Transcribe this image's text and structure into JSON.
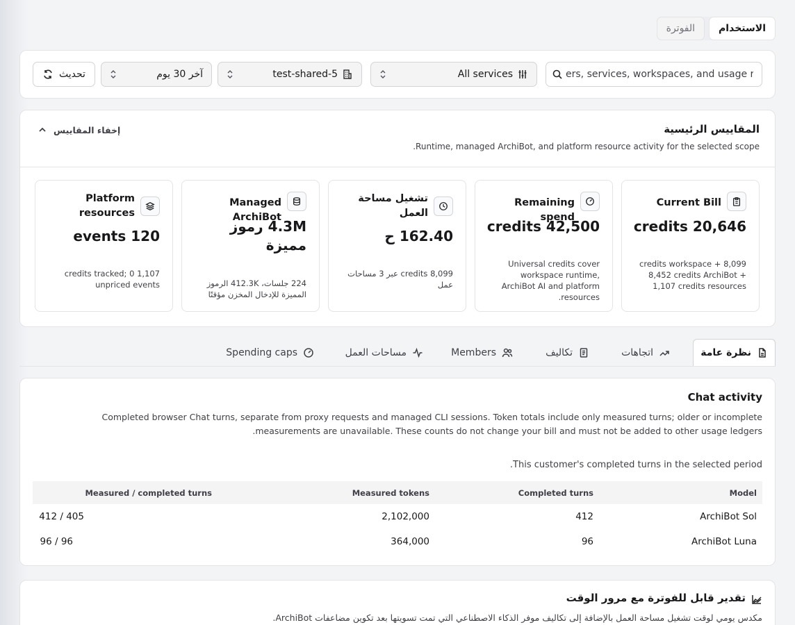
{
  "top_tabs": [
    {
      "label": "الاستخدام",
      "active": true
    },
    {
      "label": "الفوترة",
      "active": false
    }
  ],
  "filters": {
    "search_placeholder": "ers, services, workspaces, and usage rows",
    "services": "All services",
    "workspace": "test-shared-5",
    "range": "آخر 30 يوم",
    "refresh": "تحديث"
  },
  "metrics": {
    "title": "المقاييس الرئيسية",
    "subtitle": "Runtime, managed ArchiBot, and platform resource activity for the selected scope.",
    "hide_label": "إخفاء المقاييس",
    "cards": [
      {
        "label": "Current Bill",
        "value": "20,646 credits",
        "note": "8,099 credits workspace + 8,452 credits ArchiBot + 1,107 credits resources",
        "icon": "clipboard-icon"
      },
      {
        "label": "Remaining spend",
        "value": "42,500 credits",
        "note": "Universal credits cover workspace runtime, ArchiBot AI and platform resources.",
        "icon": "gauge-icon"
      },
      {
        "label": "تشغيل مساحة العمل",
        "value": "162.40 ح",
        "note": "8,099 credits عبر 3 مساحات عمل",
        "icon": "clock-icon"
      },
      {
        "label": "Managed ArchiBot",
        "value": "4.3M رموز مميزة",
        "note": "224 جلسات، 412.3K الرموز المميزة للإدخال المخزن مؤقتًا",
        "icon": "database-icon"
      },
      {
        "label": "Platform resources",
        "value": "120 events",
        "note": "1,107 credits tracked; 0 unpriced events",
        "icon": "layers-icon"
      }
    ]
  },
  "section_tabs": [
    {
      "label": "نظرة عامة",
      "icon": "document-icon",
      "active": true
    },
    {
      "label": "اتجاهات",
      "icon": "trend-icon",
      "active": false
    },
    {
      "label": "تكاليف",
      "icon": "receipt-icon",
      "active": false
    },
    {
      "label": "Members",
      "icon": "users-icon",
      "active": false
    },
    {
      "label": "مساحات العمل",
      "icon": "activity-icon",
      "active": false
    },
    {
      "label": "Spending caps",
      "icon": "gauge-icon",
      "active": false
    }
  ],
  "chat": {
    "title": "Chat activity",
    "description": "Completed browser Chat turns, separate from proxy requests and managed CLI sessions. Token totals include only measured turns; older or incomplete measurements are unavailable. These counts do not change your bill and must not be added to other usage ledgers.",
    "period_note": "This customer's completed turns in the selected period.",
    "columns": [
      "Model",
      "Completed turns",
      "Measured tokens",
      "Measured / completed turns"
    ],
    "rows": [
      {
        "model": "ArchiBot Sol",
        "turns": "412",
        "tokens": "2,102,000",
        "ratio": "405 / 412"
      },
      {
        "model": "ArchiBot Luna",
        "turns": "96",
        "tokens": "364,000",
        "ratio": "96 / 96"
      }
    ]
  },
  "bill_estimate": {
    "title": "تقدير قابل للفوترة مع مرور الوقت",
    "subtitle": "مكدس يومي لوقت تشغيل مساحة العمل بالإضافة إلى تكاليف موفر الذكاء الاصطناعي التي تمت تسويتها بعد تكوين مضاعفات ArchiBot."
  }
}
